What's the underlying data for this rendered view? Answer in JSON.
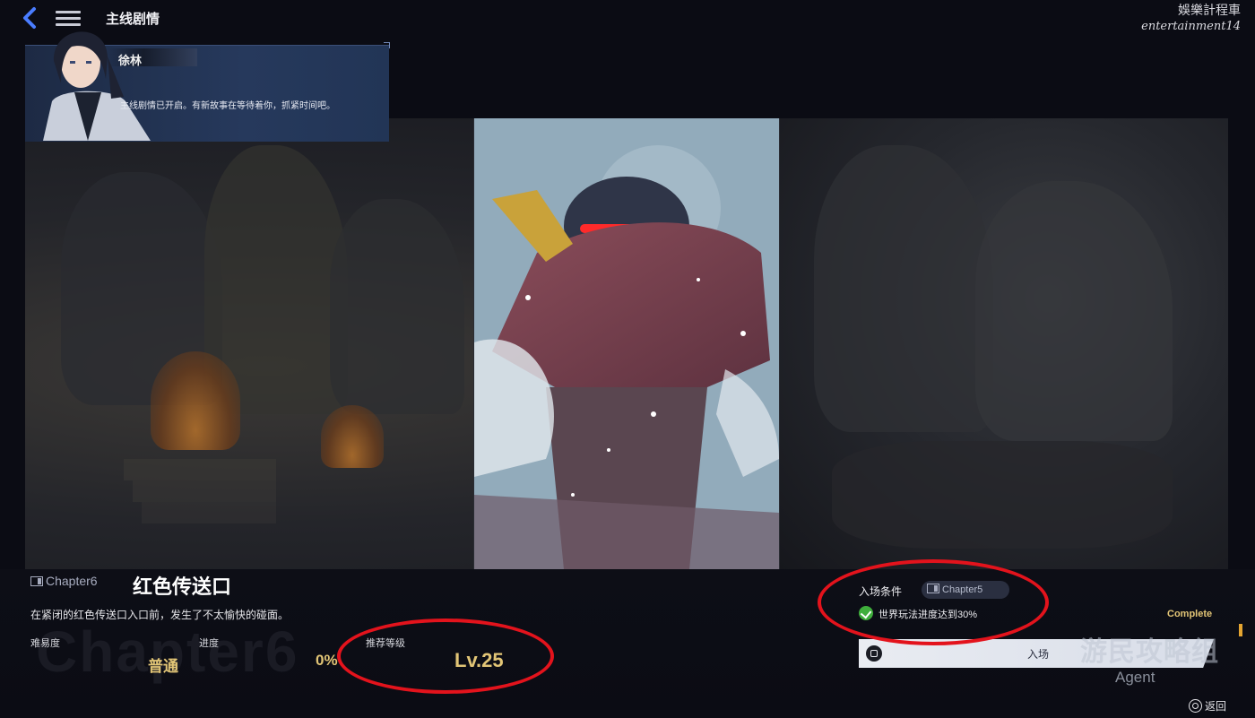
{
  "header": {
    "title": "主线剧情",
    "back_icon": "chevron-left-icon",
    "menu_icon": "menu-icon"
  },
  "watermark_top": {
    "line1": "娛樂計程車",
    "line2": "entertainment14"
  },
  "dialog": {
    "speaker": "徐林",
    "text": "主线剧情已开启。有新故事在等待着你，抓紧时间吧。"
  },
  "chapter": {
    "tag": "Chapter6",
    "title": "红色传送口",
    "description": "在紧闭的红色传送口入口前，发生了不太愉快的碰面。",
    "bg_text": "Chapter6",
    "difficulty_label": "难易度",
    "difficulty_value": "普通",
    "progress_label": "进度",
    "progress_value": "0%",
    "recommended_level_label": "推荐等级",
    "recommended_level_value": "Lv.25"
  },
  "entry": {
    "conditions_label": "入场条件",
    "required_chapter": "Chapter5",
    "requirement_text": "世界玩法进度达到30%",
    "requirement_met": true,
    "complete_label": "Complete",
    "enter_button_label": "入场"
  },
  "agent_watermark": {
    "main": "游民攻略组",
    "sub": "Agent"
  },
  "footer": {
    "back_label": "返回"
  },
  "colors": {
    "accent_gold": "#e2c576",
    "highlight_red": "#e3131c",
    "check_green": "#3fae3c",
    "back_blue": "#4a7dff"
  }
}
